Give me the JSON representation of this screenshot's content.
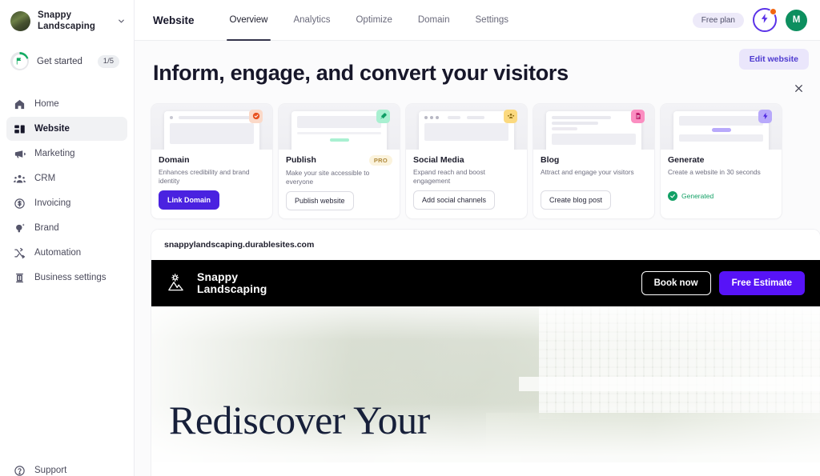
{
  "sidebar": {
    "org": {
      "name": "Snappy Landscaping",
      "avatar_icon": "org-avatar",
      "chevron_icon": "chevron-down-icon"
    },
    "get_started": {
      "label": "Get started",
      "badge": "1/5",
      "icon": "flag-icon",
      "progress": "1/5"
    },
    "items": [
      {
        "label": "Home",
        "icon": "home-icon"
      },
      {
        "label": "Website",
        "icon": "layout-icon",
        "active": true
      },
      {
        "label": "Marketing",
        "icon": "megaphone-icon"
      },
      {
        "label": "CRM",
        "icon": "people-icon"
      },
      {
        "label": "Invoicing",
        "icon": "dollar-circle-icon"
      },
      {
        "label": "Brand",
        "icon": "brand-sparkle-icon"
      },
      {
        "label": "Automation",
        "icon": "shuffle-icon"
      },
      {
        "label": "Business settings",
        "icon": "building-icon"
      }
    ],
    "support": {
      "label": "Support",
      "icon": "help-circle-icon"
    }
  },
  "topbar": {
    "page_title": "Website",
    "tabs": [
      {
        "label": "Overview",
        "active": true
      },
      {
        "label": "Analytics",
        "active": false
      },
      {
        "label": "Optimize",
        "active": false
      },
      {
        "label": "Domain",
        "active": false
      },
      {
        "label": "Settings",
        "active": false
      }
    ],
    "plan_badge": "Free plan",
    "upgrade_icon": "lightning-bolt-icon",
    "notification_dot": true,
    "avatar_initial": "M",
    "avatar_color": "#0d8f5f"
  },
  "content": {
    "edit_website_label": "Edit website",
    "close_icon": "close-icon",
    "heading": "Inform, engage, and convert your visitors",
    "cards": [
      {
        "title": "Domain",
        "description": "Enhances credibility and brand identity",
        "button": "Link Domain",
        "button_style": "primary",
        "icon": "globe-check-icon",
        "icon_bg": "#fbd9c8",
        "icon_color": "#e8521f",
        "badge": null,
        "status": null
      },
      {
        "title": "Publish",
        "description": "Make your site accessible to everyone",
        "button": "Publish website",
        "button_style": "outline",
        "icon": "rocket-icon",
        "icon_bg": "#a9f0d1",
        "icon_color": "#0f9e66",
        "badge": "PRO",
        "status": null
      },
      {
        "title": "Social Media",
        "description": "Expand reach and boost engagement",
        "button": "Add social channels",
        "button_style": "outline",
        "icon": "social-group-icon",
        "icon_bg": "#fbd97f",
        "icon_color": "#8a6a12",
        "badge": null,
        "status": null
      },
      {
        "title": "Blog",
        "description": "Attract and engage your visitors",
        "button": "Create blog post",
        "button_style": "outline",
        "icon": "document-icon",
        "icon_bg": "#fb8ec1",
        "icon_color": "#c01f6d",
        "badge": null,
        "status": null
      },
      {
        "title": "Generate",
        "description": "Create a website in 30 seconds",
        "button": null,
        "button_style": null,
        "icon": "lightning-bolt-icon",
        "icon_bg": "#b8a9fb",
        "icon_color": "#4a22e0",
        "badge": null,
        "status": "Generated"
      }
    ],
    "preview": {
      "url": "snappylandscaping.durablesites.com",
      "site": {
        "logo_text_line1": "Snappy",
        "logo_text_line2": "Landscaping",
        "logo_icon": "mountain-sun-icon",
        "book_now_label": "Book now",
        "free_estimate_label": "Free Estimate",
        "free_estimate_color": "#5713f7",
        "hero_title": "Rediscover Your"
      }
    }
  },
  "colors": {
    "accent_purple": "#4a22e0",
    "edit_btn_bg": "#eae6fb",
    "edit_btn_text": "#4e3ad0",
    "success_green": "#12a065",
    "notification_orange": "#f2650f",
    "site_black": "#000000"
  }
}
